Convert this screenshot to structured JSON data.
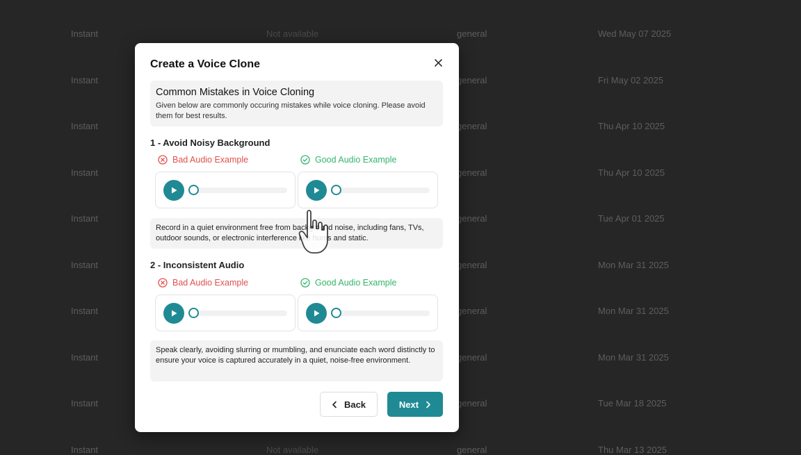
{
  "background_table": {
    "rows": [
      {
        "type": "Instant",
        "status": "Not available",
        "category": "general",
        "date": "Wed May 07 2025"
      },
      {
        "type": "Instant",
        "status": "",
        "category": "general",
        "date": "Fri May 02 2025"
      },
      {
        "type": "Instant",
        "status": "",
        "category": "general",
        "date": "Thu Apr 10 2025"
      },
      {
        "type": "Instant",
        "status": "",
        "category": "general",
        "date": "Thu Apr 10 2025"
      },
      {
        "type": "Instant",
        "status": "",
        "category": "general",
        "date": "Tue Apr 01 2025"
      },
      {
        "type": "Instant",
        "status": "",
        "category": "general",
        "date": "Mon Mar 31 2025"
      },
      {
        "type": "Instant",
        "status": "",
        "category": "general",
        "date": "Mon Mar 31 2025"
      },
      {
        "type": "Instant",
        "status": "",
        "category": "general",
        "date": "Mon Mar 31 2025"
      },
      {
        "type": "Instant",
        "status": "",
        "category": "general",
        "date": "Tue Mar 18 2025"
      },
      {
        "type": "Instant",
        "status": "Not available",
        "category": "general",
        "date": "Thu Mar 13 2025"
      }
    ]
  },
  "modal": {
    "title": "Create a Voice Clone",
    "close_icon": "close-icon",
    "mistakes": {
      "heading": "Common Mistakes in Voice Cloning",
      "description": "Given below are commonly occuring mistakes while voice cloning. Please avoid them for best results."
    },
    "sections": [
      {
        "title": "1 - Avoid Noisy Background",
        "bad_label": "Bad Audio Example",
        "good_label": "Good Audio Example",
        "tip": "Record in a quiet environment free from background noise, including fans, TVs, outdoor sounds, or electronic interference like hums and static."
      },
      {
        "title": "2 - Inconsistent Audio",
        "bad_label": "Bad Audio Example",
        "good_label": "Good Audio Example",
        "tip": "Speak clearly, avoiding slurring or mumbling, and enunciate each word distinctly to ensure your voice is captured accurately in a quiet, noise-free environment."
      }
    ],
    "players": {
      "progress": 0
    },
    "buttons": {
      "back": "Back",
      "next": "Next"
    }
  },
  "colors": {
    "accent": "#1f8a94",
    "bad": "#e0504f",
    "good": "#33b56c",
    "overlay": "#262626"
  }
}
